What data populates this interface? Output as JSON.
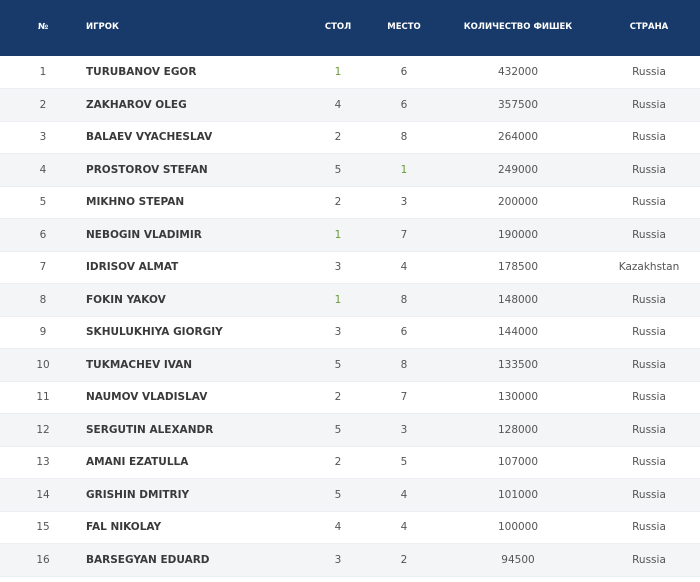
{
  "columns": {
    "num": "№",
    "player": "игрок",
    "table": "стол",
    "place": "место",
    "chips": "количество фишек",
    "country": "страна"
  },
  "rows": [
    {
      "num": "1",
      "player": "TURUBANOV EGOR",
      "table": "1",
      "place": "6",
      "chips": "432000",
      "country": "Russia"
    },
    {
      "num": "2",
      "player": "ZAKHAROV OLEG",
      "table": "4",
      "place": "6",
      "chips": "357500",
      "country": "Russia"
    },
    {
      "num": "3",
      "player": "BALAEV VYACHESLAV",
      "table": "2",
      "place": "8",
      "chips": "264000",
      "country": "Russia"
    },
    {
      "num": "4",
      "player": "PROSTOROV STEFAN",
      "table": "5",
      "place": "1",
      "chips": "249000",
      "country": "Russia"
    },
    {
      "num": "5",
      "player": "MIKHNO STEPAN",
      "table": "2",
      "place": "3",
      "chips": "200000",
      "country": "Russia"
    },
    {
      "num": "6",
      "player": "NEBOGIN VLADIMIR",
      "table": "1",
      "place": "7",
      "chips": "190000",
      "country": "Russia"
    },
    {
      "num": "7",
      "player": "IDRISOV ALMAT",
      "table": "3",
      "place": "4",
      "chips": "178500",
      "country": "Kazakhstan"
    },
    {
      "num": "8",
      "player": "FOKIN YAKOV",
      "table": "1",
      "place": "8",
      "chips": "148000",
      "country": "Russia"
    },
    {
      "num": "9",
      "player": "SKHULUKHIYA GIORGIY",
      "table": "3",
      "place": "6",
      "chips": "144000",
      "country": "Russia"
    },
    {
      "num": "10",
      "player": "TUKMACHEV IVAN",
      "table": "5",
      "place": "8",
      "chips": "133500",
      "country": "Russia"
    },
    {
      "num": "11",
      "player": "NAUMOV VLADISLAV",
      "table": "2",
      "place": "7",
      "chips": "130000",
      "country": "Russia"
    },
    {
      "num": "12",
      "player": "SERGUTIN ALEXANDR",
      "table": "5",
      "place": "3",
      "chips": "128000",
      "country": "Russia"
    },
    {
      "num": "13",
      "player": "AMANI EZATULLA",
      "table": "2",
      "place": "5",
      "chips": "107000",
      "country": "Russia"
    },
    {
      "num": "14",
      "player": "GRISHIN DMITRIY",
      "table": "5",
      "place": "4",
      "chips": "101000",
      "country": "Russia"
    },
    {
      "num": "15",
      "player": "FAL NIKOLAY",
      "table": "4",
      "place": "4",
      "chips": "100000",
      "country": "Russia"
    },
    {
      "num": "16",
      "player": "BARSEGYAN EDUARD",
      "table": "3",
      "place": "2",
      "chips": "94500",
      "country": "Russia"
    }
  ],
  "colors": {
    "header_bg": "#173a6a",
    "row_alt_bg": "#f4f5f7",
    "highlight": "#6b9a3c"
  }
}
